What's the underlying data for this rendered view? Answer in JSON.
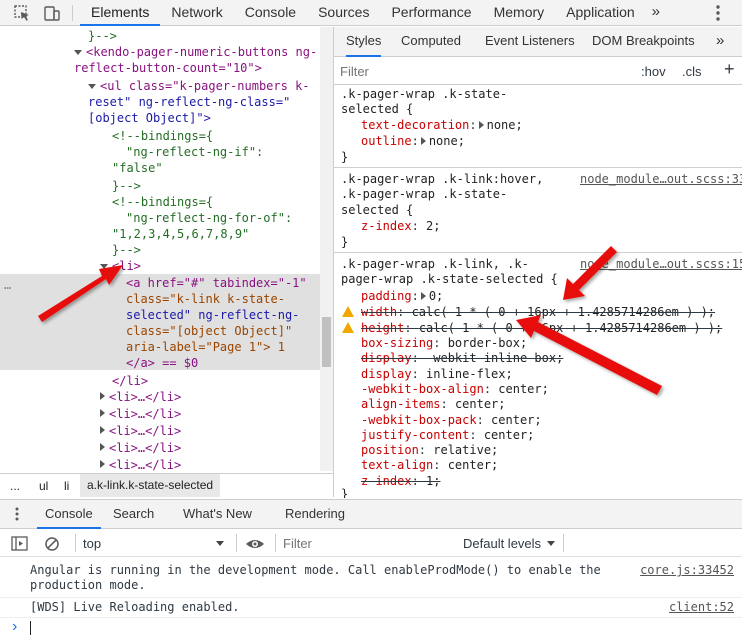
{
  "toolbar": {
    "tabs": [
      "Elements",
      "Network",
      "Console",
      "Sources",
      "Performance",
      "Memory",
      "Application"
    ],
    "more": "»"
  },
  "elements": {
    "lines": [
      "}-->",
      "<kendo-pager-numeric-buttons ng-",
      "reflect-button-count=\"10\">",
      "<ul class=\"k-pager-numbers k-",
      "reset\" ng-reflect-ng-class=\"",
      "[object Object]\">",
      "<!--bindings={",
      "\"ng-reflect-ng-if\":",
      "\"false\"",
      "}-->",
      "<!--bindings={",
      "\"ng-reflect-ng-for-of\":",
      "\"1,2,3,4,5,6,7,8,9\"",
      "}-->",
      "<li>",
      "<a href=\"#\" tabindex=\"-1\"",
      "class=\"k-link k-state-",
      "selected\" ng-reflect-ng-",
      "class=\"[object Object]\"",
      "aria-label=\"Page 1\"> 1",
      "</a> == $0",
      "</li>",
      "<li>…</li>",
      "<li>…</li>",
      "<li>…</li>",
      "<li>…</li>",
      "<li>…</li>"
    ],
    "ellipsis": "…"
  },
  "breadcrumb": [
    "...",
    "ul",
    "li",
    "a.k-link.k-state-selected"
  ],
  "styles_tabs": [
    "Styles",
    "Computed",
    "Event Listeners",
    "DOM Breakpoints"
  ],
  "filter": {
    "placeholder": "Filter",
    "hov": ":hov",
    "cls": ".cls",
    "add": "+"
  },
  "rules": {
    "r1": {
      "sel1": ".k-pager-wrap .k-state-",
      "sel2": "selected {",
      "p1": "text-decoration",
      "v1": "none;",
      "p2": "outline",
      "v2": "none;",
      "close": "}"
    },
    "r2": {
      "sel1": ".k-pager-wrap .k-link:hover,",
      "sel2": ".k-pager-wrap .k-state-",
      "sel3": "selected {",
      "src": "node_module…out.scss:33",
      "p1": "z-index",
      "v1": "2;",
      "close": "}"
    },
    "r3": {
      "sel1": ".k-pager-wrap .k-link, .k-",
      "sel2": "pager-wrap .k-state-selected {",
      "src": "node_module…out.scss:15",
      "decls": [
        {
          "p": "padding",
          "v": "0;"
        },
        {
          "p": "width",
          "v": "calc( 1 * ( 0 + 16px + 1.4285714286em ) );"
        },
        {
          "p": "height",
          "v": "calc( 1 * ( 0 + 16px + 1.4285714286em ) );"
        },
        {
          "p": "box-sizing",
          "v": "border-box;"
        },
        {
          "p": "display",
          "v": "-webkit-inline-box;"
        },
        {
          "p": "display",
          "v": "inline-flex;"
        },
        {
          "p": "-webkit-box-align",
          "v": "center;"
        },
        {
          "p": "align-items",
          "v": "center;"
        },
        {
          "p": "-webkit-box-pack",
          "v": "center;"
        },
        {
          "p": "justify-content",
          "v": "center;"
        },
        {
          "p": "position",
          "v": "relative;"
        },
        {
          "p": "text-align",
          "v": "center;"
        },
        {
          "p": "z-index",
          "v": "1;"
        }
      ],
      "close": "}"
    }
  },
  "drawer": {
    "tabs": [
      "Console",
      "Search",
      "What's New",
      "Rendering"
    ],
    "context": "top",
    "filter_placeholder": "Filter",
    "levels": "Default levels"
  },
  "console": {
    "msg1": "Angular is running in the development mode. Call enableProdMode() to enable the\nproduction mode.",
    "msg1_src": "core.js:33452",
    "msg2": "[WDS] Live Reloading enabled.",
    "msg2_src": "client:52",
    "prompt": "›"
  },
  "colors": {
    "accent": "#1a73e8",
    "arrow": "#e8100c",
    "selected_row": "#e0e0e0",
    "warning": "#f2a600"
  }
}
